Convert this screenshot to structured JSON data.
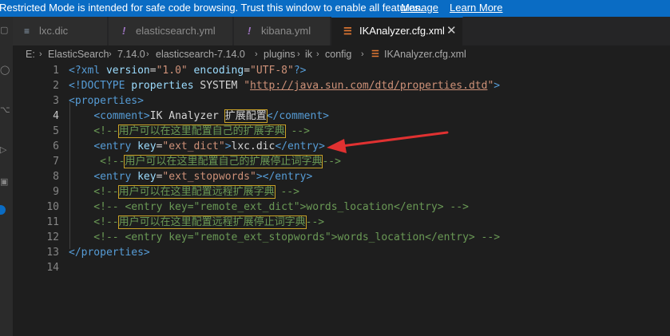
{
  "banner": {
    "message": "Restricted Mode is intended for safe code browsing. Trust this window to enable all features.",
    "manage": "Manage",
    "learn_more": "Learn More"
  },
  "tabs": [
    {
      "icon": "≡",
      "label": "lxc.dic",
      "active": false
    },
    {
      "icon": "!",
      "label": "elasticsearch.yml",
      "active": false
    },
    {
      "icon": "!",
      "label": "kibana.yml",
      "active": false
    },
    {
      "icon": "☰",
      "label": "IKAnalyzer.cfg.xml",
      "active": true,
      "close": "✕"
    }
  ],
  "breadcrumb": [
    "E:",
    "ElasticSearch",
    "7.14.0",
    "elasticsearch-7.14.0",
    "plugins",
    "ik",
    "config",
    "IKAnalyzer.cfg.xml"
  ],
  "breadcrumb_sep": "›",
  "lines": [
    {
      "n": "1",
      "s": "<?xml version=\"1.0\" encoding=\"UTF-8\"?>"
    },
    {
      "n": "2",
      "s": "<!DOCTYPE properties SYSTEM \"http://java.sun.com/dtd/properties.dtd\">"
    },
    {
      "n": "3",
      "s": "<properties>"
    },
    {
      "n": "4",
      "s": "    <comment>IK Analyzer 扩展配置</comment>"
    },
    {
      "n": "5",
      "s": "    <!--用户可以在这里配置自己的扩展字典 -->"
    },
    {
      "n": "6",
      "s": "    <entry key=\"ext_dict\">lxc.dic</entry>"
    },
    {
      "n": "7",
      "s": "     <!--用户可以在这里配置自己的扩展停止词字典-->"
    },
    {
      "n": "8",
      "s": "    <entry key=\"ext_stopwords\"></entry>"
    },
    {
      "n": "9",
      "s": "    <!--用户可以在这里配置远程扩展字典 -->"
    },
    {
      "n": "10",
      "s": "    <!-- <entry key=\"remote_ext_dict\">words_location</entry> -->"
    },
    {
      "n": "11",
      "s": "    <!--用户可以在这里配置远程扩展停止词字典-->"
    },
    {
      "n": "12",
      "s": "    <!-- <entry key=\"remote_ext_stopwords\">words_location</entry> -->"
    },
    {
      "n": "13",
      "s": "</properties>"
    },
    {
      "n": "14",
      "s": ""
    }
  ],
  "colors": {
    "banner": "#0a6cc4",
    "tag": "#569cd6",
    "attribute": "#9cdcfe",
    "string": "#ce9178",
    "comment": "#6a9955",
    "arrow": "#e03131"
  }
}
